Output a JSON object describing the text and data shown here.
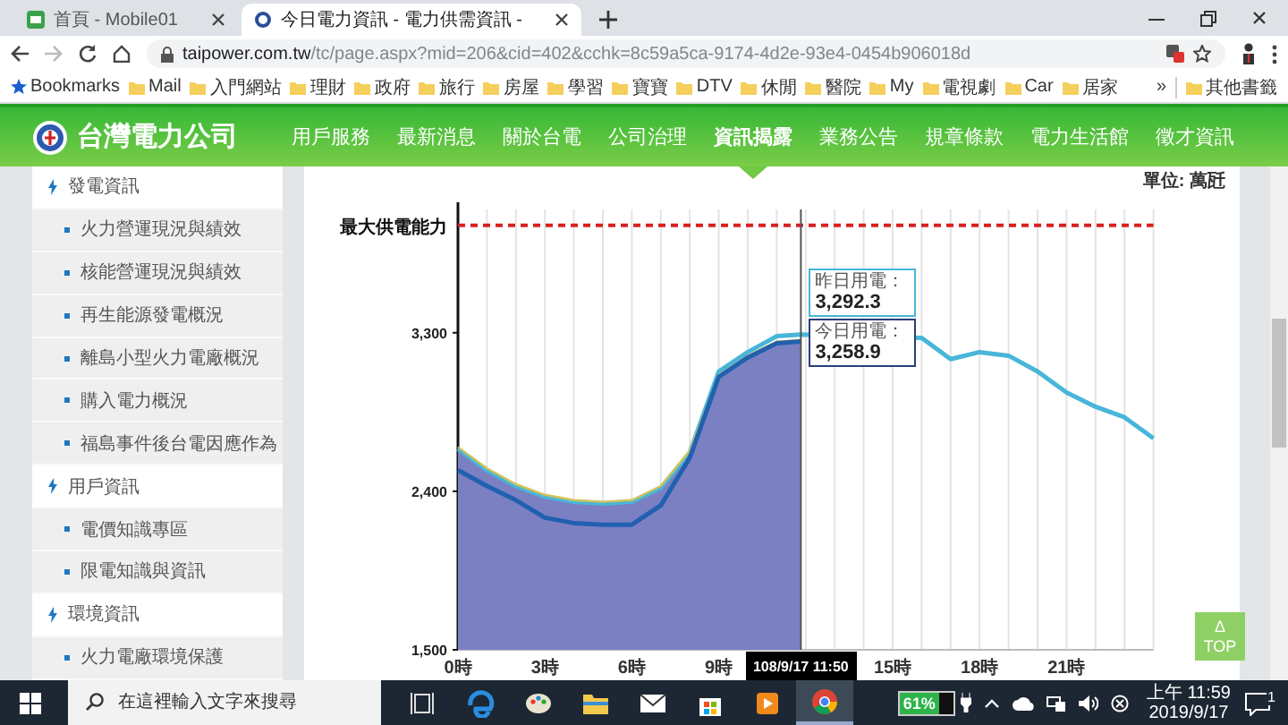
{
  "browser": {
    "tabs": [
      {
        "title": "首頁 - Mobile01",
        "selected": false
      },
      {
        "title": "今日電力資訊 - 電力供需資訊 -",
        "selected": true
      }
    ],
    "address": {
      "host": "taipower.com.tw",
      "path": "/tc/page.aspx?mid=206&cid=402&cchk=8c59a5ca-9174-4d2e-93e4-0454b906018d"
    },
    "bookmarks": {
      "label": "Bookmarks",
      "folders": [
        "Mail",
        "入門網站",
        "理財",
        "政府",
        "旅行",
        "房屋",
        "學習",
        "寶寶",
        "DTV",
        "休閒",
        "醫院",
        "My",
        "電視劇",
        "Car",
        "居家"
      ],
      "overflow": "»",
      "other": "其他書籤"
    }
  },
  "site": {
    "logo_text": "台灣電力公司",
    "nav": [
      {
        "label": "用戶服務",
        "selected": false
      },
      {
        "label": "最新消息",
        "selected": false
      },
      {
        "label": "關於台電",
        "selected": false
      },
      {
        "label": "公司治理",
        "selected": false
      },
      {
        "label": "資訊揭露",
        "selected": true
      },
      {
        "label": "業務公告",
        "selected": false
      },
      {
        "label": "規章條款",
        "selected": false
      },
      {
        "label": "電力生活館",
        "selected": false
      },
      {
        "label": "徵才資訊",
        "selected": false
      }
    ]
  },
  "sidebar": {
    "sections": [
      {
        "label": "發電資訊",
        "children": [
          {
            "label": "火力營運現況與績效"
          },
          {
            "label": "核能營運現況與績效"
          },
          {
            "label": "再生能源發電概況"
          },
          {
            "label": "離島小型火力電廠概況"
          },
          {
            "label": "購入電力概況"
          },
          {
            "label": "福島事件後台電因應作為"
          }
        ]
      },
      {
        "label": "用戶資訊",
        "children": [
          {
            "label": "電價知識專區"
          },
          {
            "label": "限電知識與資訊"
          }
        ]
      },
      {
        "label": "環境資訊",
        "children": [
          {
            "label": "火力電廠環境保護"
          }
        ]
      }
    ]
  },
  "chart": {
    "shade_first_series": true,
    "chart_data": {
      "type": "line",
      "ylabel": "單位: 萬瓩",
      "x": [
        0,
        1,
        2,
        3,
        4,
        5,
        6,
        7,
        8,
        9,
        10,
        11,
        11.833,
        16,
        17,
        18,
        19,
        20,
        21,
        22,
        23,
        24
      ],
      "series": [
        {
          "color": "#d4c25a",
          "values": [
            2650,
            2530,
            2440,
            2380,
            2350,
            2340,
            2350,
            2430,
            2630,
            3060,
            3170,
            3250,
            3260,
            null,
            null,
            null,
            null,
            null,
            null,
            null,
            null,
            null
          ]
        },
        {
          "color": "#48b6d8",
          "values": [
            2640,
            2520,
            2430,
            2370,
            2340,
            2330,
            2340,
            2420,
            2620,
            3080,
            3190,
            3280,
            3290,
            3270,
            3150,
            3190,
            3170,
            3080,
            2960,
            2880,
            2820,
            2700
          ]
        },
        {
          "color": "#2160b0",
          "values": [
            2520,
            2430,
            2350,
            2250,
            2220,
            2210,
            2210,
            2320,
            2590,
            3050,
            3160,
            3240,
            3250,
            null,
            null,
            null,
            null,
            null,
            null,
            null,
            null,
            null
          ]
        }
      ],
      "xlim": [
        0,
        24
      ],
      "ylim": [
        1500,
        4000
      ],
      "xticks": [
        {
          "value": 0,
          "label": "0時"
        },
        {
          "value": 3,
          "label": "3時"
        },
        {
          "value": 6,
          "label": "6時"
        },
        {
          "value": 9,
          "label": "9時"
        },
        {
          "value": 15,
          "label": "15時"
        },
        {
          "value": 18,
          "label": "18時"
        },
        {
          "value": 21,
          "label": "21時"
        }
      ],
      "yticks": [
        {
          "value": 1500,
          "label": "1,500"
        },
        {
          "value": 2400,
          "label": "2,400"
        },
        {
          "value": 3300,
          "label": "3,300"
        }
      ],
      "grid": true,
      "ref_lines": [
        {
          "axis": "y",
          "value": 3910,
          "label": "最大供電能力"
        },
        {
          "axis": "x",
          "value": 11.833
        }
      ]
    },
    "cursor_label": "108/9/17 11:50",
    "tooltips": [
      {
        "label": "昨日用電：",
        "value": "3,292.3",
        "color": "#48b6d8"
      },
      {
        "label": "今日用電：",
        "value": "3,258.9",
        "color": "#2a3f7a"
      }
    ]
  },
  "back_to_top": {
    "arrow": "Δ",
    "label": "TOP"
  },
  "taskbar": {
    "search": {
      "placeholder": "在這裡輸入文字來搜尋"
    },
    "apps": [
      {
        "kind": "taskview",
        "selected": false
      },
      {
        "kind": "edge",
        "selected": false
      },
      {
        "kind": "paint",
        "selected": false
      },
      {
        "kind": "folder",
        "selected": false
      },
      {
        "kind": "mail",
        "selected": false
      },
      {
        "kind": "store",
        "selected": false
      },
      {
        "kind": "media",
        "selected": false
      },
      {
        "kind": "chrome",
        "selected": true
      }
    ],
    "battery": "61%",
    "time": "上午 11:59",
    "date": "2019/9/17",
    "notifications": "1"
  }
}
